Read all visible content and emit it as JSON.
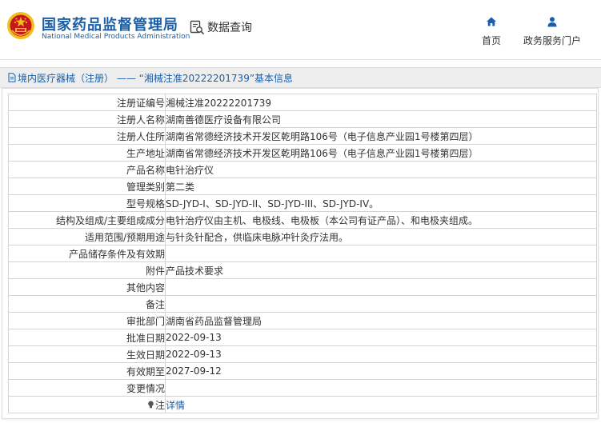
{
  "header": {
    "org_name_cn": "国家药品监督管理局",
    "org_name_en": "National Medical Products Administration",
    "query_label": "数据查询",
    "nav": {
      "home": "首页",
      "service": "政务服务门户"
    },
    "colors": {
      "brand_blue": "#1a5fa8",
      "emblem_red": "#c8161d",
      "emblem_gold": "#f2c01e"
    }
  },
  "breadcrumb": {
    "text": "境内医疗器械（注册） —— “湘械注准20222201739”基本信息"
  },
  "record": {
    "rows": [
      {
        "label": "注册证编号",
        "value": "湘械注准20222201739"
      },
      {
        "label": "注册人名称",
        "value": "湖南善德医疗设备有限公司"
      },
      {
        "label": "注册人住所",
        "value": "湖南省常德经济技术开发区乾明路106号（电子信息产业园1号楼第四层）"
      },
      {
        "label": "生产地址",
        "value": "湖南省常德经济技术开发区乾明路106号（电子信息产业园1号楼第四层）"
      },
      {
        "label": "产品名称",
        "value": "电针治疗仪"
      },
      {
        "label": "管理类别",
        "value": "第二类"
      },
      {
        "label": "型号规格",
        "value": "SD-JYD-I、SD-JYD-II、SD-JYD-III、SD-JYD-IV。"
      },
      {
        "label": "结构及组成/主要组成成分",
        "value": "电针治疗仪由主机、电极线、电极板（本公司有证产品）、和电极夹组成。"
      },
      {
        "label": "适用范围/预期用途",
        "value": "与针灸针配合，供临床电脉冲针灸疗法用。"
      },
      {
        "label": "产品储存条件及有效期",
        "value": ""
      },
      {
        "label": "附件",
        "value": "产品技术要求"
      },
      {
        "label": "其他内容",
        "value": ""
      },
      {
        "label": "备注",
        "value": ""
      },
      {
        "label": "审批部门",
        "value": "湖南省药品监督管理局"
      },
      {
        "label": "批准日期",
        "value": "2022-09-13"
      },
      {
        "label": "生效日期",
        "value": "2022-09-13"
      },
      {
        "label": "有效期至",
        "value": "2027-09-12"
      },
      {
        "label": "变更情况",
        "value": ""
      }
    ],
    "note": {
      "label": "注",
      "link_text": "详情",
      "icon": "lightbulb-icon"
    }
  }
}
